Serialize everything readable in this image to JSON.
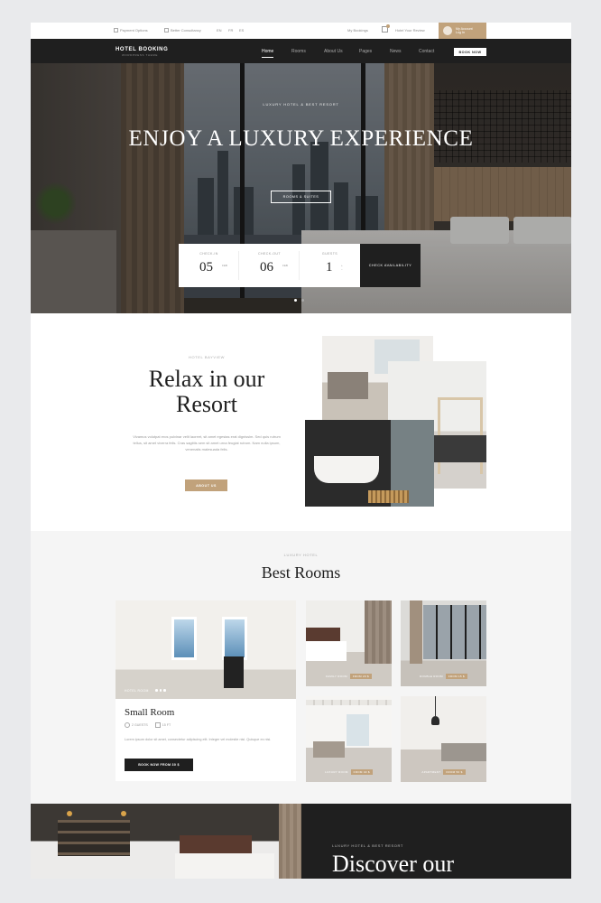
{
  "topbar": {
    "payment_label": "Payment Options",
    "consult_label": "Better Consultancy",
    "lang_items": [
      "EN",
      "FR",
      "ES"
    ],
    "bookings_label": "My Bookings",
    "review_label": "Hotel Your Review",
    "user_line1": "My Account",
    "user_line2": "Log In"
  },
  "nav": {
    "logo": "HOTEL BOOKING",
    "logo_sub": "WORDPRESS THEME",
    "links": [
      "Home",
      "Rooms",
      "About Us",
      "Pages",
      "News",
      "Contact"
    ],
    "cta": "BOOK NOW"
  },
  "hero": {
    "kicker": "LUXURY HOTEL & BEST RESORT",
    "title": "ENJOY A LUXURY EXPERIENCE",
    "button": "ROOMS & SUITES",
    "checkin_label": "CHECK-IN",
    "checkin_day": "05",
    "checkin_month": "FEB",
    "checkout_label": "CHECK-OUT",
    "checkout_day": "06",
    "checkout_month": "FEB",
    "guests_label": "GUESTS",
    "guests_value": "1",
    "check_button": "CHECK AVAILABILITY"
  },
  "about": {
    "kicker": "HOTEL BAYVIEW",
    "title": "Relax in our Resort",
    "text": "Vivamus volutpat eros pulvinar velit laoreet, sit amet egestas erat dignissim. Sed quis rutrum tellus, sit amet viverra felis. Cras sagittis sem sit amet urna feugiat rutrum. Nam nulla ipsum, venenatis malesuada felis.",
    "button": "ABOUT US"
  },
  "rooms": {
    "kicker": "LUXURY HOTEL",
    "title": "Best Rooms",
    "featured": {
      "image_label": "HOTEL ROOM",
      "name": "Small Room",
      "guests": "2 GUESTS",
      "size": "15 FT",
      "description": "Lorem ipsum dolor sit amet, consectetur adipiscing elit. Integer vel molestie nisl. Quisque ex nisi.",
      "cta": "BOOK NOW FROM 30 $"
    },
    "cards": [
      {
        "name": "FAMILY ROOM",
        "price": "FROM 20 $"
      },
      {
        "name": "DOUBLE ROOM",
        "price": "FROM 15 $"
      },
      {
        "name": "LUXURY ROOM",
        "price": "FROM 40 $"
      },
      {
        "name": "APARTMENT",
        "price": "FROM 50 $"
      }
    ]
  },
  "discover": {
    "kicker": "LUXURY HOTEL & BEST RESORT",
    "title": "Discover our"
  }
}
